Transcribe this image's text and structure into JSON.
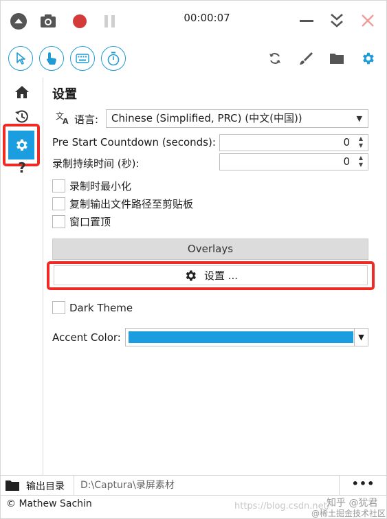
{
  "titlebar": {
    "timer": "00:00:07",
    "icons": [
      "collapse-icon",
      "screenshot-icon",
      "record-icon",
      "pause-icon",
      "minimize-icon",
      "expand-icon",
      "close-icon"
    ]
  },
  "toolbar": {
    "left_tools": [
      "cursor-icon",
      "click-icon",
      "keyboard-icon",
      "timer-icon"
    ],
    "right_tools": [
      "refresh-icon",
      "brush-icon",
      "folder-icon",
      "gear-icon"
    ],
    "accent": "#1f9bd6"
  },
  "sidebar": {
    "items": [
      "home-icon",
      "history-icon",
      "settings-icon",
      "help-icon"
    ],
    "help_glyph": "?",
    "active": "settings-icon",
    "active_color": "#1c9de0",
    "highlight_color": "#ee2a24"
  },
  "settings": {
    "title": "设置",
    "language_label": "语言:",
    "language_value": "Chinese (Simplified, PRC) (中文(中国))",
    "countdown_label": "Pre Start Countdown (seconds):",
    "countdown_value": "0",
    "duration_label": "录制持续时间 (秒):",
    "duration_value": "0",
    "checkboxes": [
      {
        "label": "录制时最小化",
        "checked": false
      },
      {
        "label": "复制输出文件路径至剪贴板",
        "checked": false
      },
      {
        "label": "窗口置顶",
        "checked": false
      }
    ],
    "overlays_label": "Overlays",
    "settings_button_label": "设置 ...",
    "dark_theme_label": "Dark Theme",
    "dark_theme_checked": false,
    "accent_label": "Accent Color:",
    "accent_color": "#1c9de0"
  },
  "bottom": {
    "output_label": "输出目录",
    "output_path": "D:\\Captura\\录屏素材",
    "more_label": "•••",
    "copyright": "© Mathew Sachin"
  },
  "watermark": {
    "blog": "https://blog.csdn.net/",
    "zhihu": "知乎 @犹君",
    "juejin": "@稀土掘金技术社区"
  }
}
